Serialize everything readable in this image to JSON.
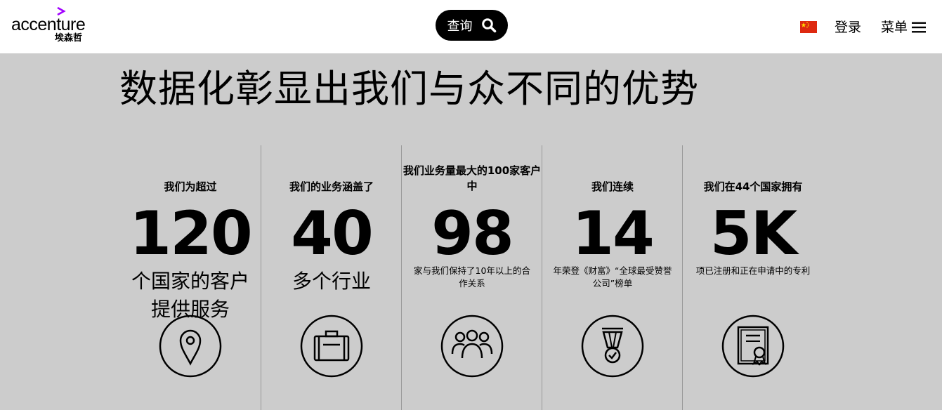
{
  "header": {
    "logo_text": "accenture",
    "logo_cn": "埃森哲",
    "search_label": "查询",
    "login_label": "登录",
    "menu_label": "菜单"
  },
  "headline": "数据化彰显出我们与众不同的优势",
  "stats": [
    {
      "label": "我们为超过",
      "value": "120",
      "desc": "个国家的客户提供服务",
      "icon": "map-pin-icon"
    },
    {
      "label": "我们的业务涵盖了",
      "value": "40",
      "desc": "多个行业",
      "icon": "briefcase-icon"
    },
    {
      "label": "我们业务量最大的100家客户中",
      "value": "98",
      "desc": "家与我们保持了10年以上的合作关系",
      "icon": "people-group-icon"
    },
    {
      "label": "我们连续",
      "value": "14",
      "desc": "年荣登《财富》“全球最受赞誉公司”榜单",
      "icon": "medal-icon"
    },
    {
      "label": "我们在44个国家拥有",
      "value": "5K",
      "desc": "项已注册和正在申请中的专利",
      "icon": "certificate-icon"
    }
  ],
  "colors": {
    "brand_accent": "#a100ff",
    "background": "#cccccc",
    "header_bg": "#ffffff",
    "flag_red": "#de2910",
    "flag_yellow": "#ffde00"
  }
}
